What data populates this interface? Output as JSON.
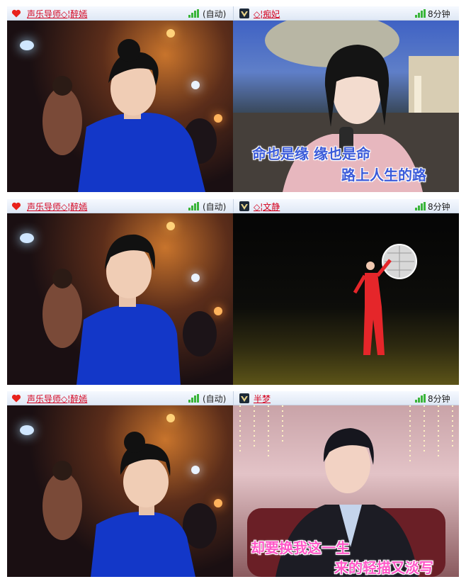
{
  "rows": [
    {
      "left": {
        "username": "声乐导师◇¦醉嫣",
        "mode": "(自动)"
      },
      "right": {
        "username": "◇¦痴妃",
        "duration": "8分钟",
        "lyrics": [
          "命也是缘  缘也是命",
          "路上人生的路"
        ]
      }
    },
    {
      "left": {
        "username": "声乐导师◇¦醉嫣",
        "mode": "(自动)"
      },
      "right": {
        "username": "◇¦文静",
        "duration": "8分钟",
        "lyrics": []
      }
    },
    {
      "left": {
        "username": "声乐导师◇¦醉嫣",
        "mode": "(自动)"
      },
      "right": {
        "username": "半梦",
        "duration": "8分钟",
        "lyrics": [
          "却要换我这一生",
          "来的轻描又淡写"
        ]
      }
    }
  ],
  "colors": {
    "username": "#d4001c",
    "signal": "#3ab53a",
    "lyric_blue": "#3b5bd9",
    "lyric_pink": "#ff58c8",
    "shirt": "#1337c8"
  },
  "icons": {
    "left_badge": "heart-icon",
    "right_badge": "vip-badge-icon",
    "signal": "signal-icon"
  }
}
